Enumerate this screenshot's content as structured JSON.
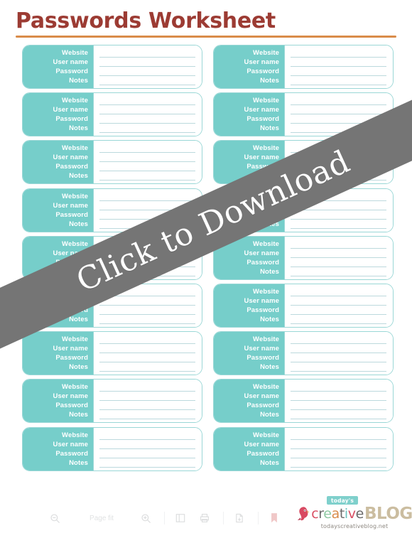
{
  "document": {
    "title": "Passwords Worksheet",
    "background_color": "#ffffff",
    "title_color": "#9c3b33",
    "rule_color": "#d98c4a",
    "accent_teal": "#76ceca",
    "line_color": "#bcd9dd"
  },
  "entry_labels": {
    "website": "Website",
    "user_name": "User name",
    "password": "Password",
    "notes": "Notes"
  },
  "entries": [
    {
      "id": 1,
      "column": "left",
      "website": "",
      "user_name": "",
      "password": "",
      "notes": ""
    },
    {
      "id": 2,
      "column": "right",
      "website": "",
      "user_name": "",
      "password": "",
      "notes": ""
    },
    {
      "id": 3,
      "column": "left",
      "website": "",
      "user_name": "",
      "password": "",
      "notes": ""
    },
    {
      "id": 4,
      "column": "right",
      "website": "",
      "user_name": "",
      "password": "",
      "notes": ""
    },
    {
      "id": 5,
      "column": "left",
      "website": "",
      "user_name": "",
      "password": "",
      "notes": ""
    },
    {
      "id": 6,
      "column": "right",
      "website": "",
      "user_name": "",
      "password": "",
      "notes": ""
    },
    {
      "id": 7,
      "column": "left",
      "website": "",
      "user_name": "",
      "password": "",
      "notes": ""
    },
    {
      "id": 8,
      "column": "right",
      "website": "",
      "user_name": "",
      "password": "",
      "notes": ""
    },
    {
      "id": 9,
      "column": "left",
      "website": "",
      "user_name": "",
      "password": "",
      "notes": ""
    },
    {
      "id": 10,
      "column": "right",
      "website": "",
      "user_name": "",
      "password": "",
      "notes": ""
    },
    {
      "id": 11,
      "column": "left",
      "website": "",
      "user_name": "",
      "password": "",
      "notes": ""
    },
    {
      "id": 12,
      "column": "right",
      "website": "",
      "user_name": "",
      "password": "",
      "notes": ""
    },
    {
      "id": 13,
      "column": "left",
      "website": "",
      "user_name": "",
      "password": "",
      "notes": ""
    },
    {
      "id": 14,
      "column": "right",
      "website": "",
      "user_name": "",
      "password": "",
      "notes": ""
    },
    {
      "id": 15,
      "column": "left",
      "website": "",
      "user_name": "",
      "password": "",
      "notes": ""
    },
    {
      "id": 16,
      "column": "right",
      "website": "",
      "user_name": "",
      "password": "",
      "notes": ""
    },
    {
      "id": 17,
      "column": "left",
      "website": "",
      "user_name": "",
      "password": "",
      "notes": ""
    },
    {
      "id": 18,
      "column": "right",
      "website": "",
      "user_name": "",
      "password": "",
      "notes": ""
    }
  ],
  "overlay": {
    "label": "Click to Download",
    "color": "#757575",
    "text_color": "#ffffff"
  },
  "toolbar": {
    "zoom_out_icon": "zoom-out-icon",
    "zoom_level": "Page fit",
    "zoom_in_icon": "zoom-in-icon",
    "sidebar_icon": "sidebar-toggle-icon",
    "print_icon": "print-icon",
    "download_icon": "download-icon",
    "bookmark_icon": "bookmark-icon"
  },
  "logo": {
    "badge": "today's",
    "bird_icon": "bird-icon",
    "word_creative": "creative",
    "word_blog": "BLOG",
    "url": "todayscreativeblog.net"
  }
}
